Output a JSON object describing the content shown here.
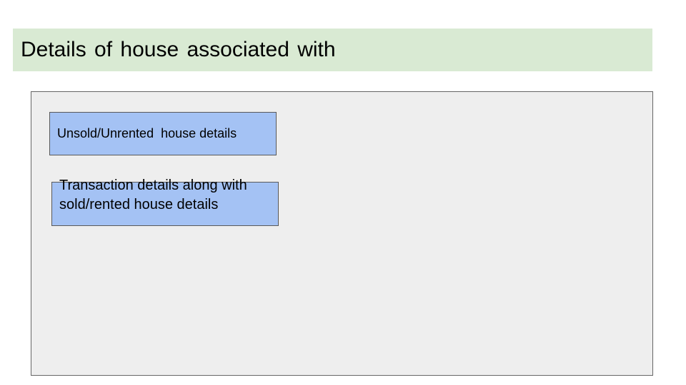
{
  "slide": {
    "title": "Details of house associated with",
    "boxes": [
      {
        "label": "Unsold/Unrented  house details"
      },
      {
        "label": "Transaction details along with sold/rented house details"
      }
    ]
  },
  "colors": {
    "title_background": "#d9ead3",
    "panel_background": "#eeeeee",
    "box_fill": "#a4c2f4",
    "box_border": "#595959"
  }
}
